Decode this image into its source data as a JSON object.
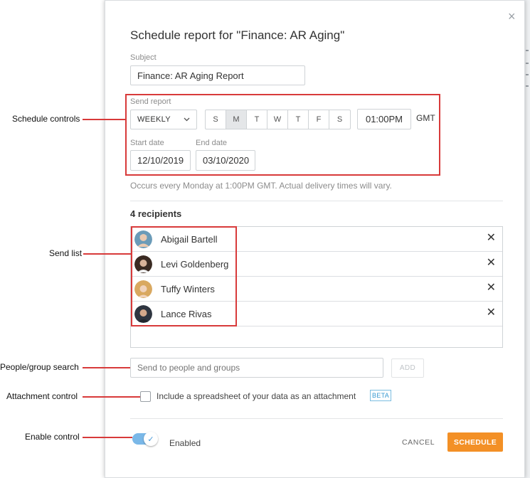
{
  "modal": {
    "title": "Schedule report for \"Finance: AR Aging\"",
    "close_glyph": "×",
    "subject": {
      "label": "Subject",
      "value": "Finance: AR Aging Report"
    },
    "send_report": {
      "label": "Send report",
      "frequency": "WEEKLY",
      "days": [
        "S",
        "M",
        "T",
        "W",
        "T",
        "F",
        "S"
      ],
      "selected_day": "M",
      "time": "01:00PM",
      "timezone": "GMT",
      "start_date_label": "Start date",
      "start_date": "12/10/2019",
      "end_date_label": "End date",
      "end_date": "03/10/2020"
    },
    "summary": "Occurs every Monday at 1:00PM GMT. Actual delivery times will vary.",
    "recipients": {
      "heading": "4 recipients",
      "remove_glyph": "✕",
      "list": [
        {
          "name": "Abigail Bartell",
          "avatar_color": "#6b9bb8"
        },
        {
          "name": "Levi Goldenberg",
          "avatar_color": "#3a2a22"
        },
        {
          "name": "Tuffy Winters",
          "avatar_color": "#d9a860"
        },
        {
          "name": "Lance Rivas",
          "avatar_color": "#2e3540"
        }
      ]
    },
    "search": {
      "placeholder": "Send to people and groups",
      "add_label": "ADD"
    },
    "attachment": {
      "label": "Include a spreadsheet of your data as an attachment",
      "badge": "BETA"
    },
    "enabled": {
      "label": "Enabled",
      "on": true,
      "check_glyph": "✓"
    },
    "footer": {
      "cancel_label": "CANCEL",
      "schedule_label": "SCHEDULE"
    }
  },
  "annotations": {
    "schedule_controls": "Schedule controls",
    "send_list": "Send list",
    "people_search": "People/group search",
    "attachment_control": "Attachment control",
    "enable_control": "Enable control"
  },
  "colors": {
    "accent": "#f39026",
    "callout": "#d83a3a",
    "toggle": "#7ab8e8",
    "beta": "#3a9ad1"
  }
}
